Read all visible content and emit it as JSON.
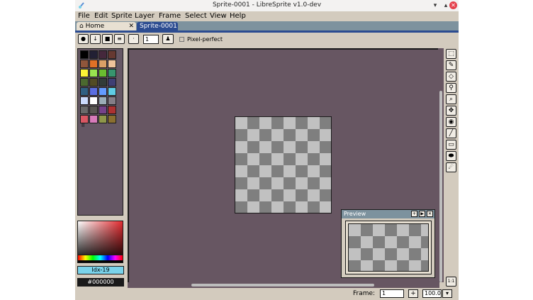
{
  "window": {
    "title": "Sprite-0001 - LibreSprite v1.0-dev",
    "minimize_glyph": "▾",
    "maximize_glyph": "▴",
    "close_glyph": "✕"
  },
  "menu": [
    "File",
    "Edit",
    "Sprite",
    "Layer",
    "Frame",
    "Select",
    "View",
    "Help"
  ],
  "tabs": [
    {
      "label": "Home",
      "icon": "home-icon",
      "close": "✕"
    },
    {
      "label": "Sprite-0001",
      "icon": "",
      "close": ""
    }
  ],
  "context_bar": {
    "brush_size": "1",
    "pixel_perfect_label": "Pixel-perfect"
  },
  "palette": {
    "colors": [
      "#000000",
      "#222034",
      "#45283c",
      "#663931",
      "#8f563b",
      "#df7126",
      "#d9a066",
      "#eec39a",
      "#fbf236",
      "#99e550",
      "#6abe30",
      "#37946e",
      "#4b692f",
      "#524b24",
      "#323c39",
      "#3f3f74",
      "#306082",
      "#5b6ee1",
      "#639bff",
      "#5fcde4",
      "#cbdbfc",
      "#ffffff",
      "#9badb7",
      "#847e87",
      "#696a6a",
      "#595652",
      "#76428a",
      "#ac3232",
      "#d95763",
      "#d77bba",
      "#8f974a",
      "#8a6f30"
    ],
    "label": "II"
  },
  "color_picker": {
    "index_label": "Idx-19",
    "hex_label": "#000000"
  },
  "preview": {
    "title": "Preview"
  },
  "tools": [
    "rectangular-marquee-icon",
    "pencil-icon",
    "eraser-icon",
    "eyedropper-icon",
    "zoom-icon",
    "move-icon",
    "paint-bucket-icon",
    "line-icon",
    "rectangle-icon",
    "ellipse-icon",
    "blur-icon"
  ],
  "statusbar": {
    "frame_label": "Frame:",
    "frame_value": "1",
    "add_label": "+",
    "zoom_value": "100.0",
    "zoom_one_label": "1:1"
  }
}
